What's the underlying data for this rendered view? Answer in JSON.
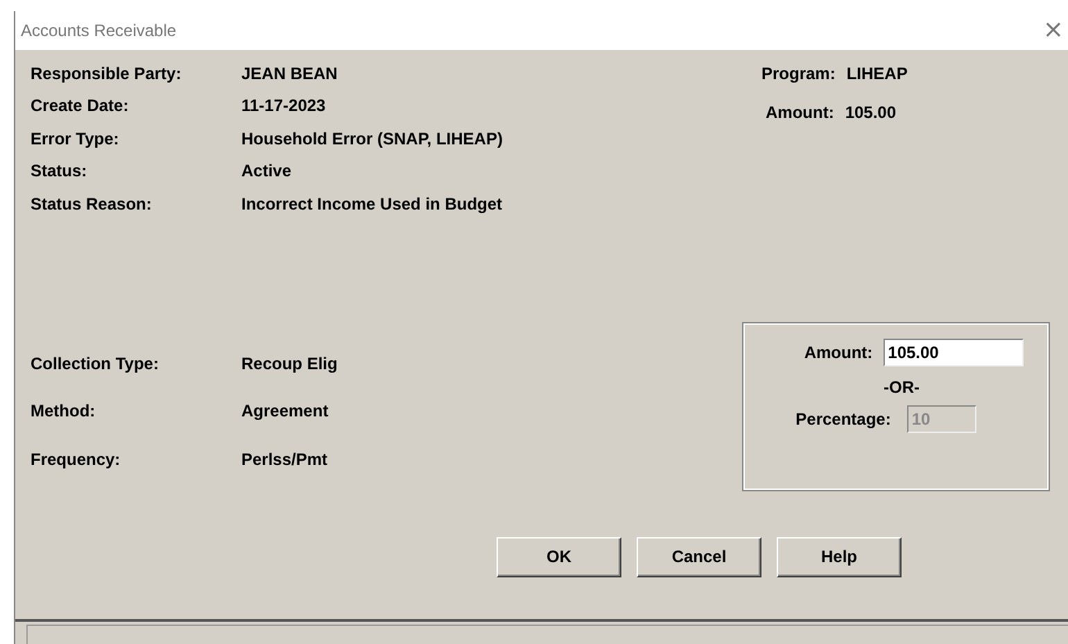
{
  "window": {
    "title": "Accounts Receivable",
    "close": "×"
  },
  "details": [
    {
      "label": "Responsible Party:",
      "value": "JEAN BEAN"
    },
    {
      "label": "Create Date:",
      "value": "11-17-2023"
    },
    {
      "label": "Error Type:",
      "value": "Household Error (SNAP, LIHEAP)"
    },
    {
      "label": "Status:",
      "value": "Active"
    },
    {
      "label": "Status Reason:",
      "value": "Incorrect Income Used in Budget"
    }
  ],
  "summary": [
    {
      "label": "Program:",
      "value": "LIHEAP"
    },
    {
      "label": "Amount:",
      "value": "105.00"
    }
  ],
  "collection": [
    {
      "label": "Collection Type:",
      "value": "Recoup Elig"
    },
    {
      "label": "Method:",
      "value": "Agreement"
    },
    {
      "label": "Frequency:",
      "value": "Perlss/Pmt"
    }
  ],
  "payment": {
    "amount": {
      "label": "Amount:",
      "value": "105.00",
      "disabled": false
    },
    "separator": "-OR-",
    "percentage": {
      "label": "Percentage:",
      "value": "10",
      "disabled": true
    }
  },
  "buttons": [
    "OK",
    "Cancel",
    "Help"
  ]
}
